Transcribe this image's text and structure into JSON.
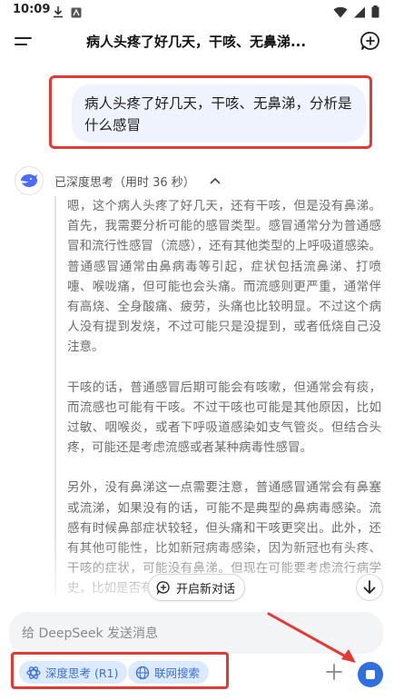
{
  "status_bar": {
    "time": "10:09",
    "left_icons": [
      "download-icon",
      "app-icon"
    ],
    "right_icons": [
      "wifi-icon",
      "signal-icon",
      "battery-icon"
    ]
  },
  "header": {
    "title": "病人头疼了好几天，干咳、无鼻涕..."
  },
  "user_message": {
    "text": "病人头疼了好几天，干咳、无鼻涕，分析是什么感冒"
  },
  "thinking": {
    "label": "已深度思考（用时 36 秒）",
    "paragraphs": [
      "嗯，这个病人头疼了好几天，还有干咳，但是没有鼻涕。首先，我需要分析可能的感冒类型。感冒通常分为普通感冒和流行性感冒（流感），还有其他类型的上呼吸道感染。普通感冒通常由鼻病毒等引起，症状包括流鼻涕、打喷嚏、喉咙痛，但可能也会头痛。而流感则更严重，通常伴有高烧、全身酸痛、疲劳，头痛也比较明显。不过这个病人没有提到发烧，不过可能只是没提到，或者低烧自己没注意。",
      "干咳的话，普通感冒后期可能会有咳嗽，但通常会有痰，而流感也可能有干咳。不过干咳也可能是其他原因，比如过敏、咽喉炎，或者下呼吸道感染如支气管炎。但结合头疼，可能还是考虑流感或者某种病毒性感冒。",
      "另外，没有鼻涕这一点需要注意，普通感冒通常会有鼻塞或流涕，如果没有的话，可能不是典型的鼻病毒感染。流感有时候鼻部症状较轻，但头痛和干咳更突出。此外，还有其他可能性，比如新冠病毒感染，因为新冠也有头疼、干咳的症状，可能没有鼻涕。但现在可能要考虑流行病学史，比如是否有接触史，或者"
    ]
  },
  "floating": {
    "new_conversation_label": "开启新对话"
  },
  "input": {
    "placeholder": "给 DeepSeek 发送消息"
  },
  "modes": {
    "deep_think_label": "深度思考 (R1)",
    "web_search_label": "联网搜索"
  },
  "colors": {
    "accent": "#2f6fe0",
    "annotation": "#e53935",
    "user_bubble": "#eef3fd",
    "mode_chip": "#dbeafe"
  }
}
